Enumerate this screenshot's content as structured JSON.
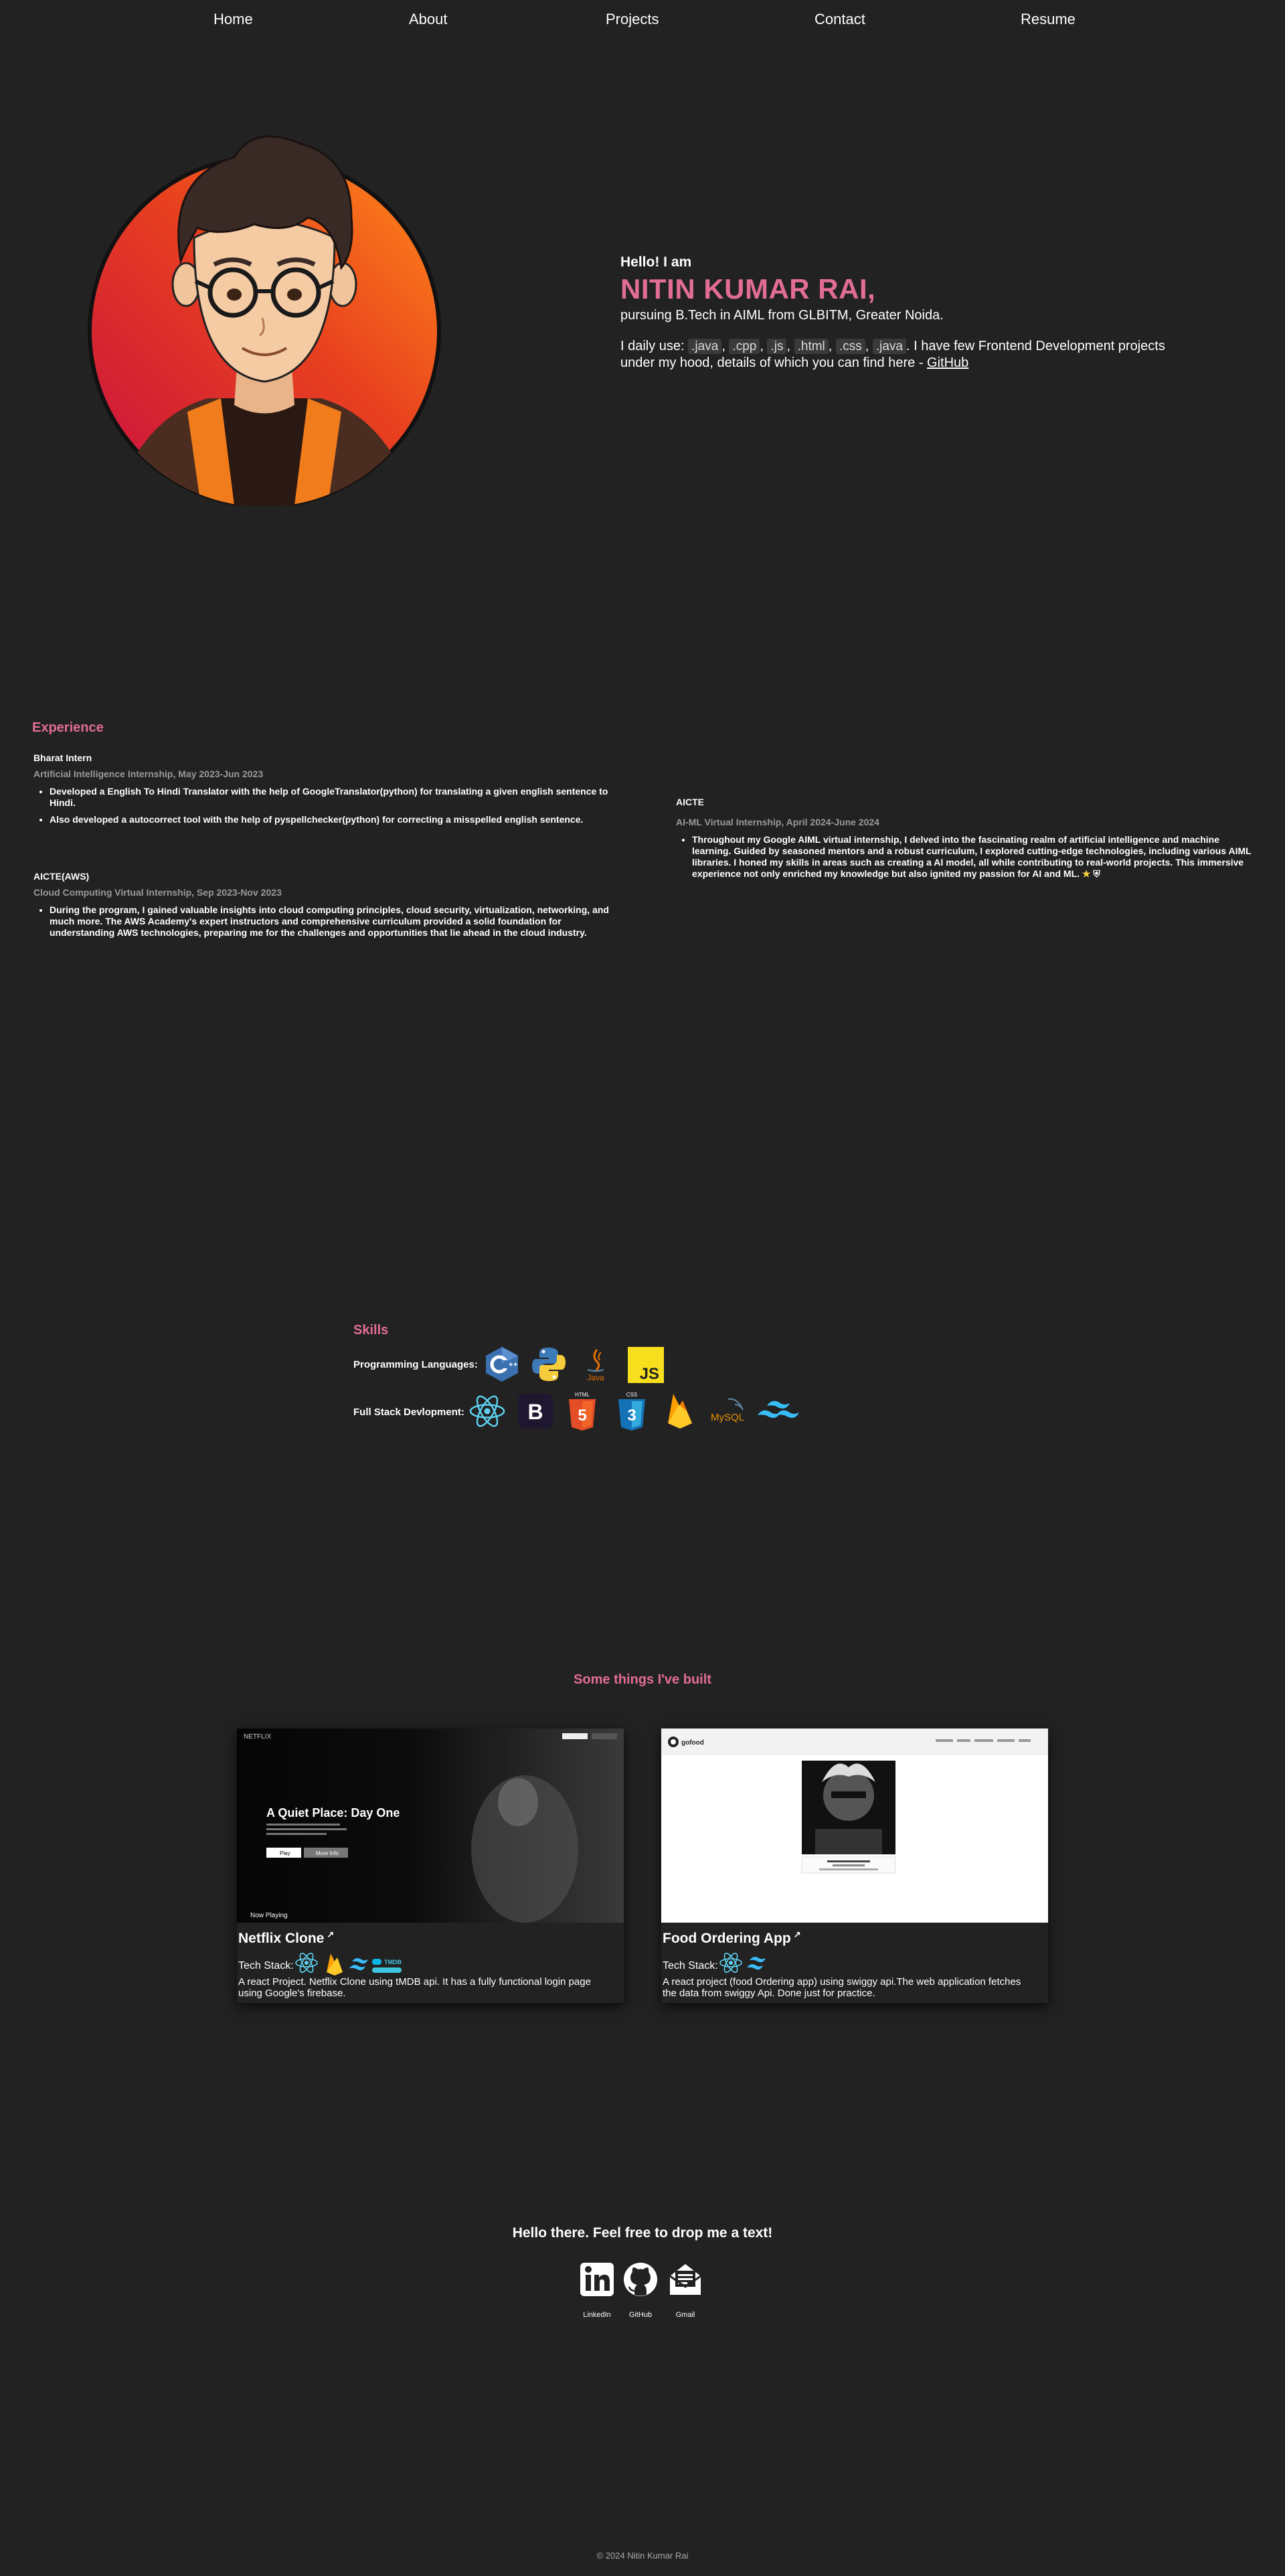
{
  "nav": {
    "items": [
      {
        "label": "Home"
      },
      {
        "label": "About"
      },
      {
        "label": "Projects"
      },
      {
        "label": "Contact"
      },
      {
        "label": "Resume"
      }
    ]
  },
  "hero": {
    "greeting": "Hello! I am",
    "name": "NITIN KUMAR RAI,",
    "pursuing": "pursuing B.Tech in AIML from GLBITM, Greater Noida.",
    "daily_prefix": "I daily use:",
    "daily_langs": [
      ".java",
      ".cpp",
      ".js",
      ".html",
      ".css",
      ".java"
    ],
    "daily_suffix": ". I have few Frontend Development projects under my hood, details of which you can find here -",
    "github_link": "GitHub"
  },
  "experience": {
    "title": "Experience",
    "items": [
      {
        "org": "Bharat Intern",
        "role": "Artificial Intelligence Internship, May 2023-Jun 2023",
        "points": [
          "Developed a English To Hindi Translator with the help of GoogleTranslator(python) for translating a given english sentence to Hindi.",
          "Also developed a autocorrect tool with the help of pyspellchecker(python) for correcting a misspelled english sentence."
        ]
      },
      {
        "org": "AICTE(AWS)",
        "role": "Cloud Computing Virtual Internship, Sep 2023-Nov 2023",
        "points": [
          "During the program, I gained valuable insights into cloud computing principles, cloud security, virtualization, networking, and much more. The AWS Academy's expert instructors and comprehensive curriculum provided a solid foundation for understanding AWS technologies, preparing me for the challenges and opportunities that lie ahead in the cloud industry."
        ]
      },
      {
        "org": "AICTE",
        "role": "AI-ML Virtual Internship, April 2024-June 2024",
        "points": [
          "Throughout my Google AIML virtual internship, I delved into the fascinating realm of artificial intelligence and machine learning. Guided by seasoned mentors and a robust curriculum, I explored cutting-edge technologies, including various AIML libraries. I honed my skills in areas such as creating a AI model, all while contributing to real-world projects. This immersive experience not only enriched my knowledge but also ignited my passion for AI and ML."
        ]
      }
    ]
  },
  "skills": {
    "title": "Skills",
    "languages_label": "Programming Languages:",
    "languages": [
      "c-plus-plus-icon",
      "python-icon",
      "java-icon",
      "javascript-icon"
    ],
    "fullstack_label": "Full Stack Devlopment:",
    "fullstack": [
      "react-icon",
      "bootstrap-icon",
      "html5-icon",
      "css3-icon",
      "firebase-icon",
      "mysql-icon",
      "tailwind-icon"
    ],
    "java_text": "Java",
    "js_text": "JS",
    "bootstrap_text": "B",
    "html_text": "5",
    "css_text": "3",
    "mysql_text": "MySQL",
    "html_cap": "HTML",
    "css_cap": "CSS"
  },
  "projects": {
    "title": "Some things I've built",
    "tech_label": "Tech Stack:",
    "items": [
      {
        "title": "Netflix Clone",
        "description": "A react Project. Netflix Clone using tMDB api. It has a fully functional login page using Google's firebase.",
        "preview": {
          "logo": "NETFLIX",
          "movie_title": "A Quiet Place: Day One",
          "play": "Play",
          "more": "More Info",
          "now_playing": "Now Playing",
          "tmdb": "TMDB"
        }
      },
      {
        "title": "Food Ordering App",
        "description": "A react project (food Ordering app) using swiggy api.The web application fetches the data from swiggy Api. Done just for practice.",
        "preview": {
          "logo": "gofood"
        }
      }
    ]
  },
  "contact": {
    "heading": "Hello there. Feel free to drop me a text!",
    "links": [
      {
        "label": "LinkedIn"
      },
      {
        "label": "GitHub"
      },
      {
        "label": "Gmail"
      }
    ]
  },
  "footer": {
    "text": "© 2024 Nitin Kumar Rai"
  },
  "colors": {
    "background": "#222222",
    "accent": "#e26d93",
    "muted": "#9a9a9a"
  }
}
